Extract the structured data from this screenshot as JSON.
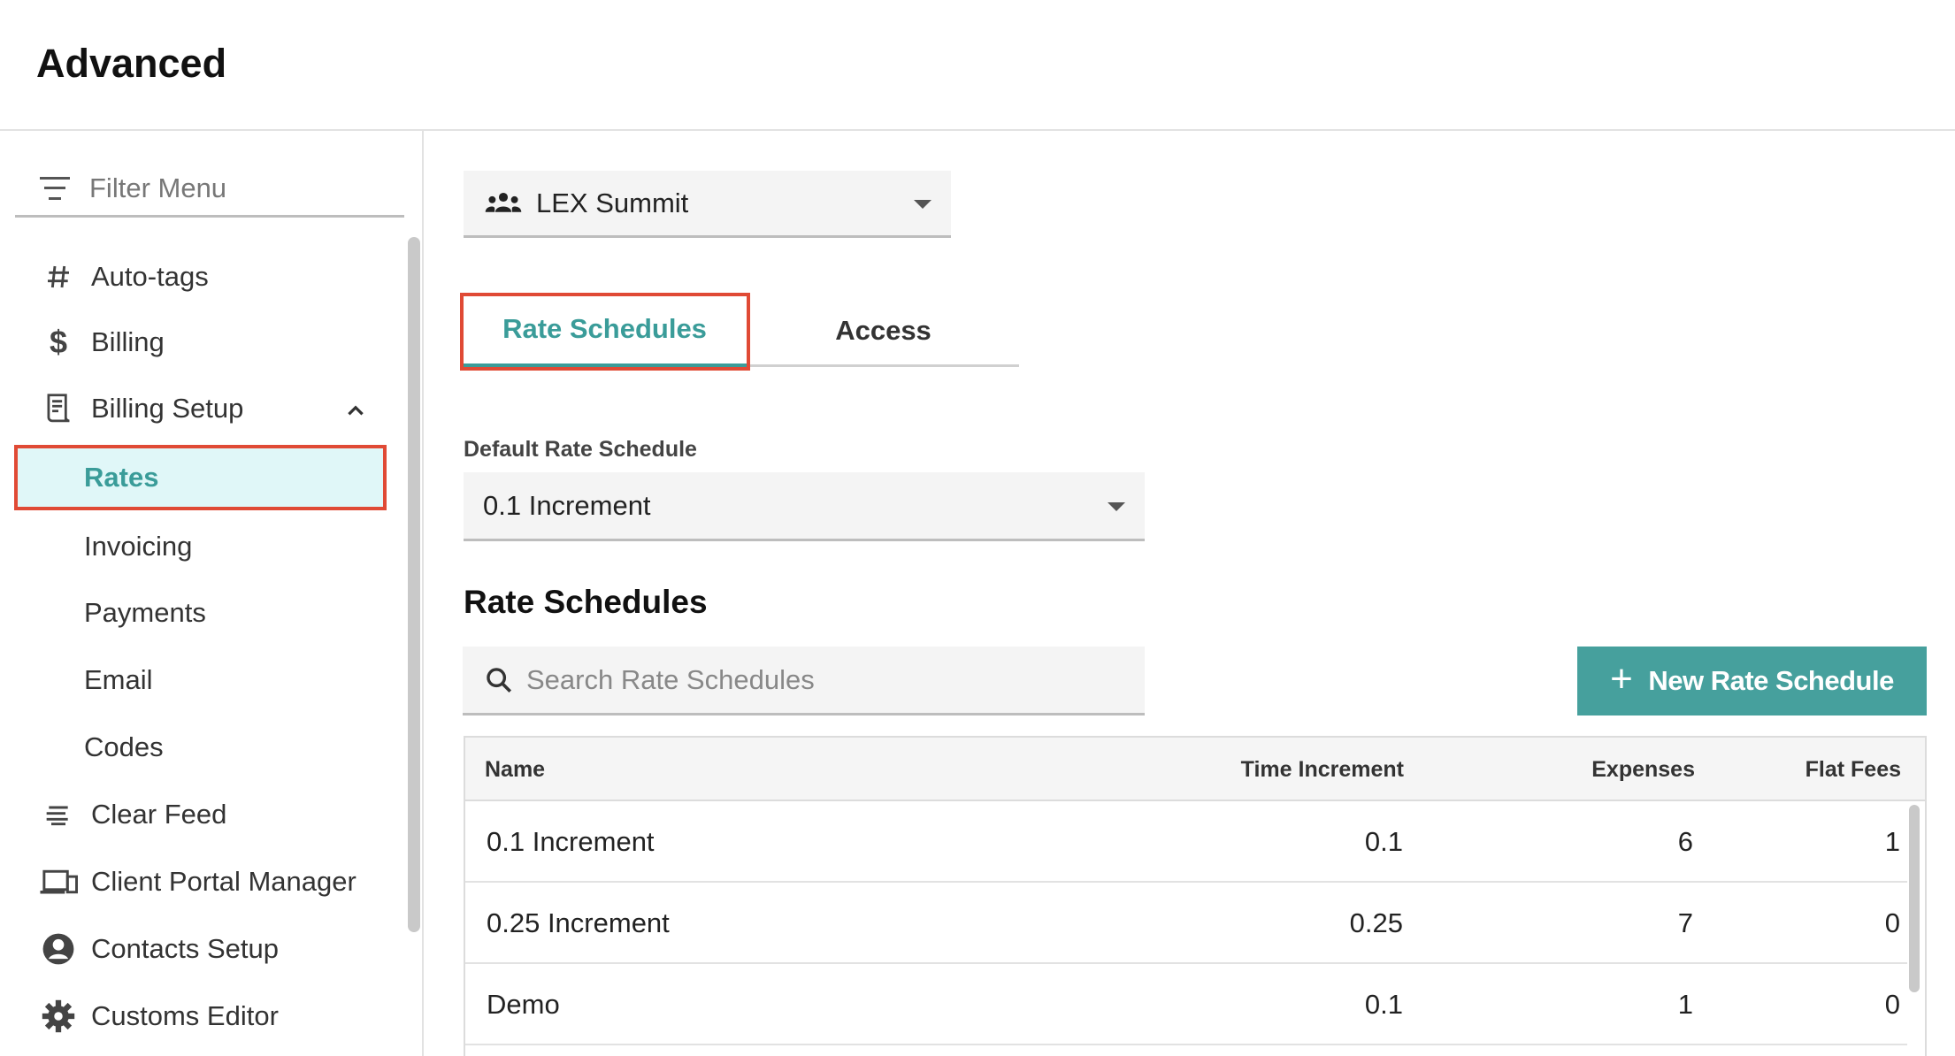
{
  "header": {
    "title": "Advanced"
  },
  "sidebar": {
    "filter_placeholder": "Filter Menu",
    "items": [
      {
        "label": "Auto-tags",
        "icon": "hash-icon"
      },
      {
        "label": "Billing",
        "icon": "dollar-icon"
      },
      {
        "label": "Billing Setup",
        "icon": "receipt-icon",
        "expanded": true
      },
      {
        "label": "Rates",
        "sub": true,
        "active": true
      },
      {
        "label": "Invoicing",
        "sub": true
      },
      {
        "label": "Payments",
        "sub": true
      },
      {
        "label": "Email",
        "sub": true
      },
      {
        "label": "Codes",
        "sub": true
      },
      {
        "label": "Clear Feed",
        "icon": "feed-icon"
      },
      {
        "label": "Client Portal Manager",
        "icon": "devices-icon"
      },
      {
        "label": "Contacts Setup",
        "icon": "account-circle-icon"
      },
      {
        "label": "Customs Editor",
        "icon": "gear-icon"
      }
    ]
  },
  "main": {
    "group_select": {
      "value": "LEX Summit",
      "icon": "group-icon"
    },
    "tabs": [
      {
        "label": "Rate Schedules",
        "active": true
      },
      {
        "label": "Access",
        "active": false
      }
    ],
    "default_rate": {
      "label": "Default Rate Schedule",
      "value": "0.1 Increment"
    },
    "section_title": "Rate Schedules",
    "search": {
      "placeholder": "Search Rate Schedules",
      "value": ""
    },
    "new_button": {
      "label": "New Rate Schedule"
    },
    "table": {
      "columns": [
        "Name",
        "Time Increment",
        "Expenses",
        "Flat Fees"
      ],
      "rows": [
        {
          "name": "0.1 Increment",
          "time_increment": "0.1",
          "expenses": "6",
          "flat_fees": "1"
        },
        {
          "name": "0.25 Increment",
          "time_increment": "0.25",
          "expenses": "7",
          "flat_fees": "0"
        },
        {
          "name": "Demo",
          "time_increment": "0.1",
          "expenses": "1",
          "flat_fees": "0"
        }
      ]
    }
  },
  "colors": {
    "accent": "#46a09d",
    "highlight": "#e04a35",
    "active_bg": "#e0f7f8"
  }
}
